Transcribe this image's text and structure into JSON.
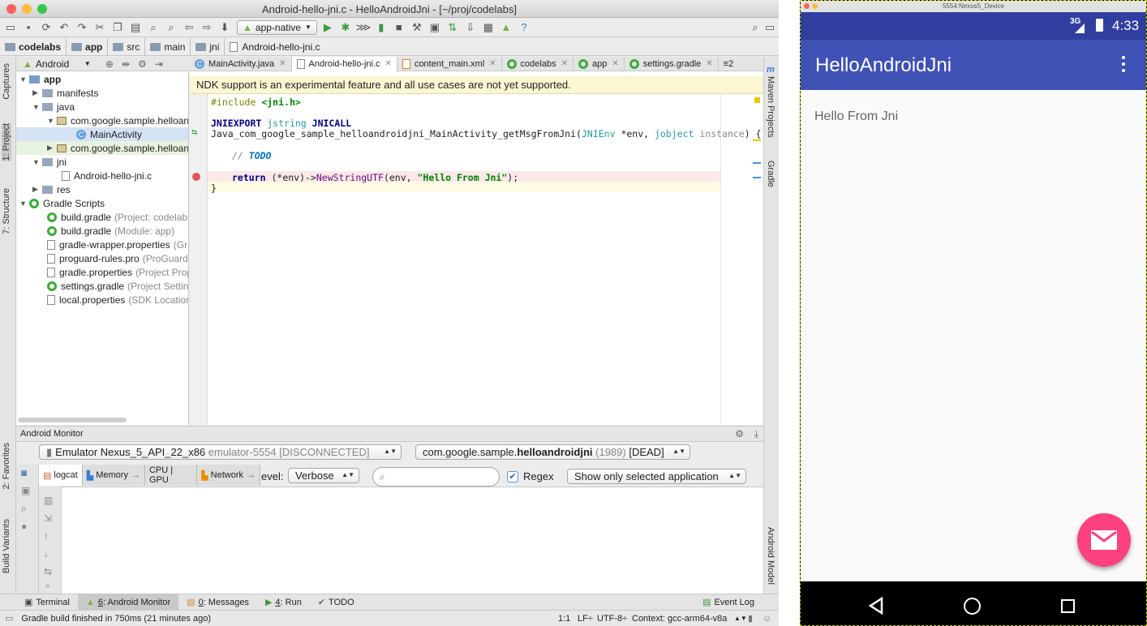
{
  "ide": {
    "window_title": "Android-hello-jni.c - HelloAndroidJni - [~/proj/codelabs]",
    "run_config": "app-native",
    "breadcrumbs": [
      "codelabs",
      "app",
      "src",
      "main",
      "jni",
      "Android-hello-jni.c"
    ],
    "left_tool_tabs": [
      "Captures",
      "1: Project",
      "7: Structure",
      "2: Favorites",
      "Build Variants"
    ],
    "right_tool_tabs": [
      "Maven Projects",
      "Gradle",
      "Android Model"
    ],
    "project_view": "Android",
    "tree": [
      {
        "label": "app",
        "dim": ""
      },
      {
        "label": "manifests",
        "dim": ""
      },
      {
        "label": "java",
        "dim": ""
      },
      {
        "label": "com.google.sample.helloan",
        "dim": ""
      },
      {
        "label": "MainActivity",
        "dim": ""
      },
      {
        "label": "com.google.sample.helloan",
        "dim": ""
      },
      {
        "label": "jni",
        "dim": ""
      },
      {
        "label": "Android-hello-jni.c",
        "dim": ""
      },
      {
        "label": "res",
        "dim": ""
      },
      {
        "label": "Gradle Scripts",
        "dim": ""
      },
      {
        "label": "build.gradle",
        "dim": "(Project: codelabs"
      },
      {
        "label": "build.gradle",
        "dim": "(Module: app)"
      },
      {
        "label": "gradle-wrapper.properties",
        "dim": "(Gr"
      },
      {
        "label": "proguard-rules.pro",
        "dim": "(ProGuard"
      },
      {
        "label": "gradle.properties",
        "dim": "(Project Prop"
      },
      {
        "label": "settings.gradle",
        "dim": "(Project Setting"
      },
      {
        "label": "local.properties",
        "dim": "(SDK Location)"
      }
    ],
    "editor_tabs": [
      "MainActivity.java",
      "Android-hello-jni.c",
      "content_main.xml",
      "codelabs",
      "app",
      "settings.gradle"
    ],
    "tab_overflow": "≡2",
    "notice": "NDK support is an experimental feature and all use cases are not yet supported.",
    "code": {
      "l1_kw": "#include",
      "l1_hdr": "<jni.h>",
      "l3_a": "JNIEXPORT",
      "l3_b": "jstring",
      "l3_c": "JNICALL",
      "l4_name": "Java_com_google_sample_helloandroidjni_MainActivity_getMsgFromJni(",
      "l4_t1": "JNIEnv",
      "l4_p1": " *env, ",
      "l4_t2": "jobject",
      "l4_p2": "instance",
      "l4_end": ") {",
      "l6_slash": "// ",
      "l6_todo": "TODO",
      "l8_ret": "return",
      "l8_mid": " (*env)->",
      "l8_fn": "NewStringUTF",
      "l8_args": "(env, ",
      "l8_str": "\"Hello From Jni\"",
      "l8_end": ");",
      "l9": "}"
    },
    "monitor": {
      "title": "Android Monitor",
      "device": "Emulator Nexus_5_API_22_x86",
      "device_serial": "emulator-5554",
      "device_state": "[DISCONNECTED]",
      "process_prefix": "com.google.sample.",
      "process_bold": "helloandroidjni",
      "process_pid": "(1989)",
      "process_state": "[DEAD]",
      "tabs": [
        "logcat",
        "Memory",
        "CPU | GPU",
        "Network"
      ],
      "level_label": "evel:",
      "level_value": "Verbose",
      "search_placeholder": "",
      "regex_label": "Regex",
      "regex_checked": true,
      "filter_value": "Show only selected application"
    },
    "bottom_tabs": [
      {
        "key": "",
        "label": "Terminal"
      },
      {
        "key": "6",
        "label": ": Android Monitor"
      },
      {
        "key": "0",
        "label": ": Messages"
      },
      {
        "key": "4",
        "label": ": Run"
      },
      {
        "key": "",
        "label": "TODO"
      }
    ],
    "event_log": "Event Log",
    "status": {
      "message": "Gradle build finished in 750ms (21 minutes ago)",
      "position": "1:1",
      "line_sep": "LF÷",
      "encoding": "UTF-8÷",
      "context": "Context: gcc-arm64-v8a"
    }
  },
  "emulator": {
    "window_title": "5554:Nexus5_Device",
    "network": "3G",
    "time": "4:33",
    "app_title": "HelloAndroidJni",
    "message": "Hello From Jni"
  },
  "colors": {
    "primary": "#3f51b5",
    "primary_dark": "#303f9f",
    "accent": "#ff4081"
  }
}
